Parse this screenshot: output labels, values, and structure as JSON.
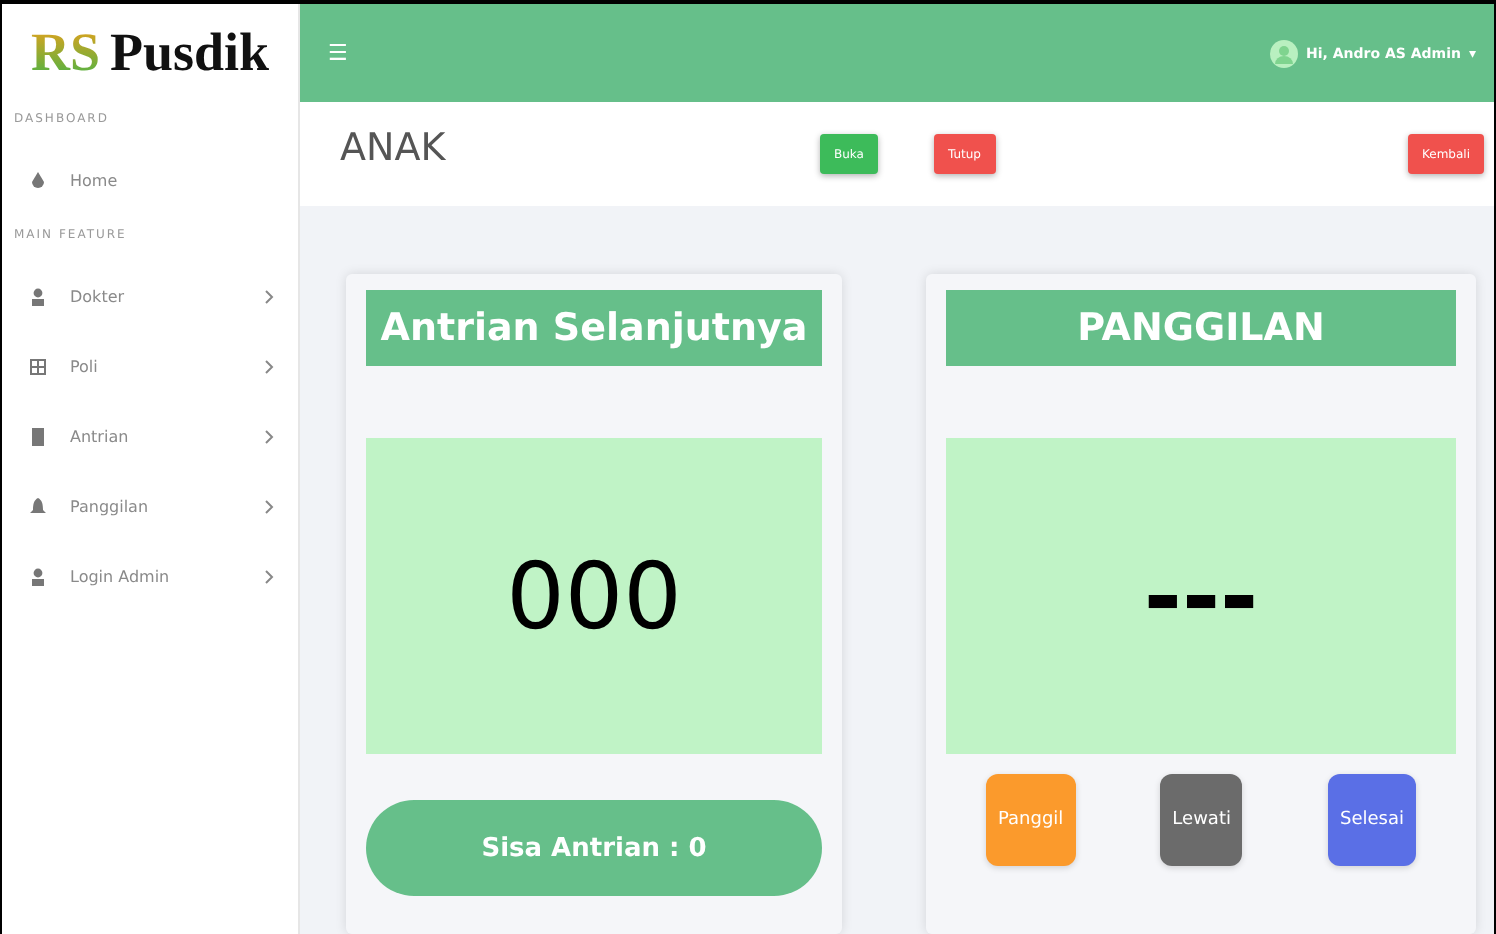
{
  "brand": {
    "part_1": "RS",
    "part_2": "Pusdik"
  },
  "sidebar": {
    "sections": [
      {
        "heading": "DASHBOARD",
        "items": [
          {
            "label": "Home",
            "has_submenu": false
          }
        ]
      },
      {
        "heading": "MAIN FEATURE",
        "items": [
          {
            "label": "Dokter",
            "has_submenu": true
          },
          {
            "label": "Poli",
            "has_submenu": true
          },
          {
            "label": "Antrian",
            "has_submenu": true
          },
          {
            "label": "Panggilan",
            "has_submenu": true
          },
          {
            "label": "Login Admin",
            "has_submenu": true
          }
        ]
      }
    ]
  },
  "topbar": {
    "menu_glyph": "☰",
    "user": "Hi, Andro AS Admin",
    "caret": "▾"
  },
  "header": {
    "title": "ANAK",
    "buttons": [
      {
        "label": "Buka",
        "color": "#3dbb5a"
      },
      {
        "label": "Tutup",
        "color": "#f0514d"
      },
      {
        "label": "Kembali",
        "color": "#f0514d"
      }
    ]
  },
  "next_card": {
    "title": "Antrian Selanjutnya",
    "number": "000",
    "remaining": "Sisa Antrian : 0"
  },
  "call_card": {
    "title": "PANGGILAN",
    "number": "---",
    "buttons": [
      {
        "label": "Panggil",
        "color": "#fb9a2c"
      },
      {
        "label": "Lewati",
        "color": "#6b6b6b"
      },
      {
        "label": "Selesai",
        "color": "#5a6fe6"
      }
    ]
  }
}
